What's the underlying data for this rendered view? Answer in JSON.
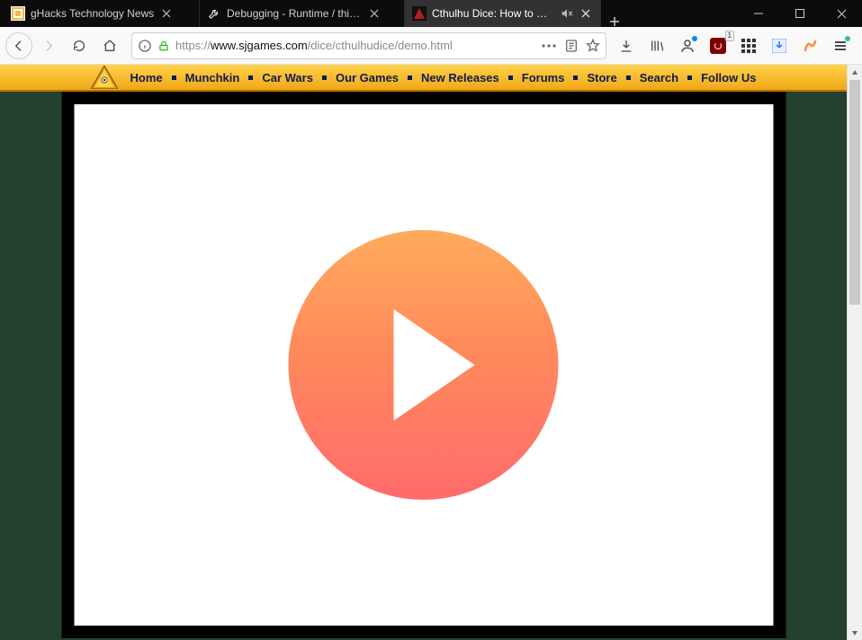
{
  "tabs": [
    {
      "title": "gHacks Technology News",
      "active": false
    },
    {
      "title": "Debugging - Runtime / this-fir",
      "active": false
    },
    {
      "title": "Cthulhu Dice: How to Play",
      "active": true
    }
  ],
  "address_bar": {
    "scheme": "https://",
    "host": "www.sjgames.com",
    "path": "/dice/cthulhudice/demo.html"
  },
  "ublock_badge": "1",
  "site_nav": {
    "items": [
      "Home",
      "Munchkin",
      "Car Wars",
      "Our Games",
      "New Releases",
      "Forums",
      "Store",
      "Search",
      "Follow Us"
    ]
  }
}
